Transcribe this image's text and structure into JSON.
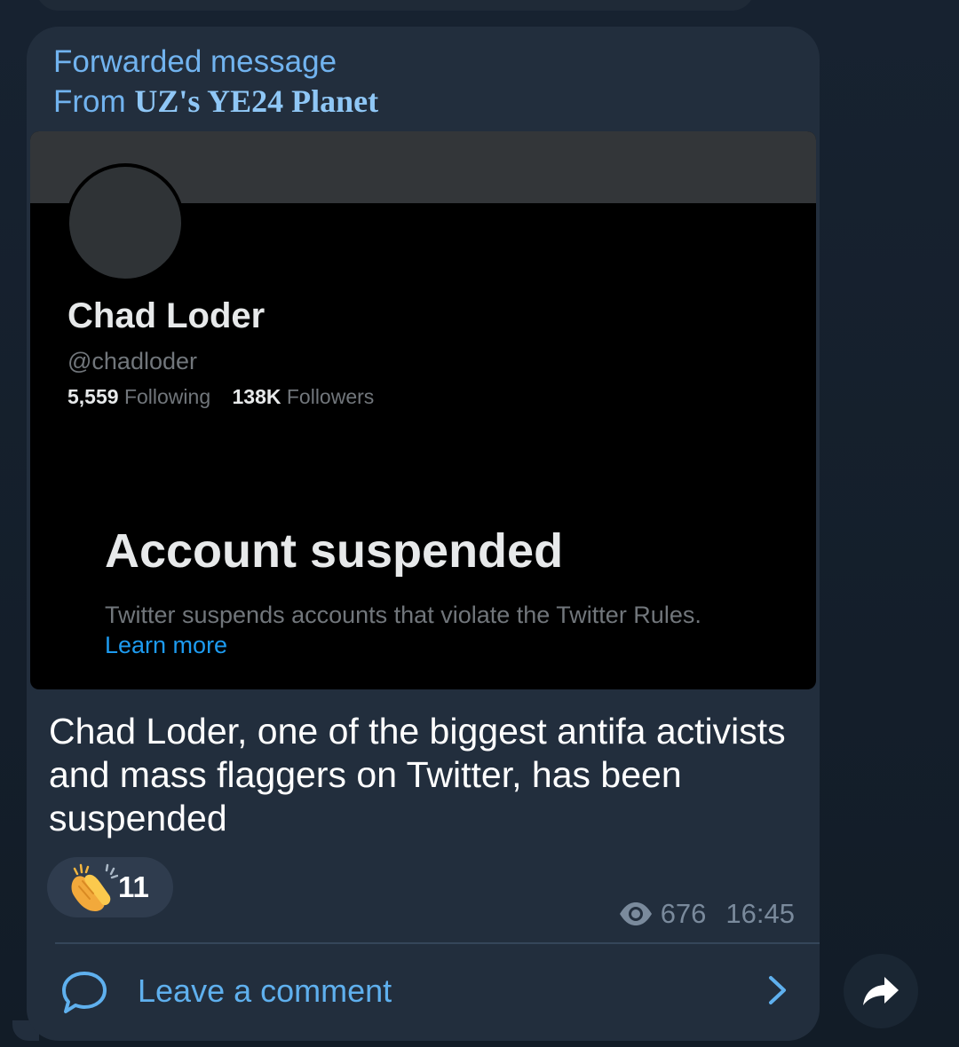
{
  "forward": {
    "label": "Forwarded message",
    "from_prefix": "From ",
    "source": "UZ's YE24 Planet"
  },
  "tweet_card": {
    "name": "Chad Loder",
    "handle": "@chadloder",
    "following_count": "5,559",
    "following_label": "Following",
    "followers_count": "138K",
    "followers_label": "Followers",
    "suspended_title": "Account suspended",
    "suspended_text": "Twitter suspends accounts that violate the Twitter Rules.",
    "learn_more": "Learn more"
  },
  "message": {
    "caption": "Chad Loder, one of the biggest antifa activists and mass flaggers on Twitter, has been suspended",
    "reaction_icon": "clapping-hands-emoji",
    "reaction_count": "11",
    "views": "676",
    "time": "16:45"
  },
  "comments": {
    "label": "Leave a comment"
  },
  "colors": {
    "accent": "#5fb0ee",
    "bubble": "#222e3d",
    "background": "#172230",
    "twitter_link": "#1d9bf0"
  }
}
